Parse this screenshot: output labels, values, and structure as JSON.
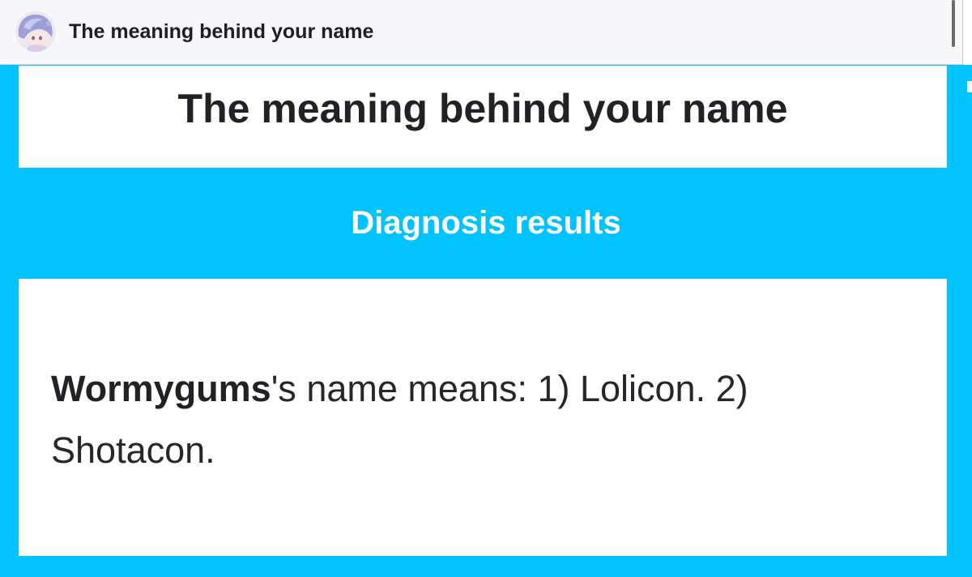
{
  "topbar": {
    "title": "The meaning behind your name",
    "avatar_icon": "anime-avatar-icon"
  },
  "page": {
    "title": "The meaning behind your name"
  },
  "results": {
    "heading": "Diagnosis results",
    "name": "Wormygums",
    "text": "'s name means: 1) Lolicon. 2) Shotacon."
  },
  "colors": {
    "background": "#00c3fe",
    "card": "#ffffff",
    "topbar": "#f7f7f9",
    "text": "#222226"
  }
}
